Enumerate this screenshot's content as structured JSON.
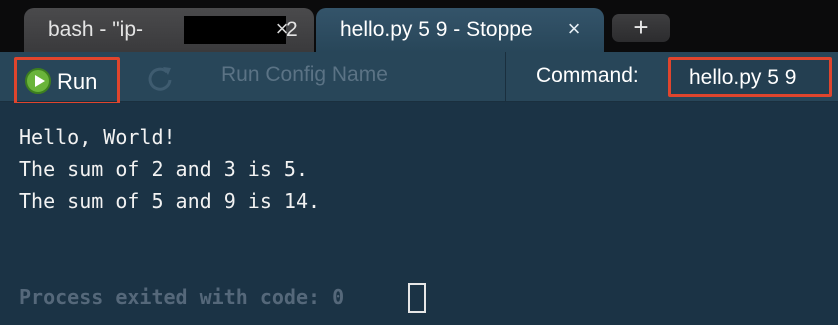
{
  "tabs": [
    {
      "label": "bash - \"ip-",
      "label_tail": "2",
      "close": "×",
      "active": false
    },
    {
      "label": "hello.py 5 9 - Stoppe",
      "close": "×",
      "active": true
    }
  ],
  "new_tab_label": "+",
  "toolbar": {
    "run_label": "Run",
    "run_config_placeholder": "Run Config Name",
    "command_label": "Command:",
    "command_value": "hello.py 5 9"
  },
  "output": {
    "lines": [
      "Hello, World!",
      "The sum of 2 and 3 is 5.",
      "The sum of 5 and 9 is 14."
    ],
    "exit_message": "Process exited with code: 0"
  },
  "colors": {
    "background": "#1b3345",
    "toolbar": "#284659",
    "highlight_border": "#e0452d",
    "run_icon": "#6ab43a"
  }
}
